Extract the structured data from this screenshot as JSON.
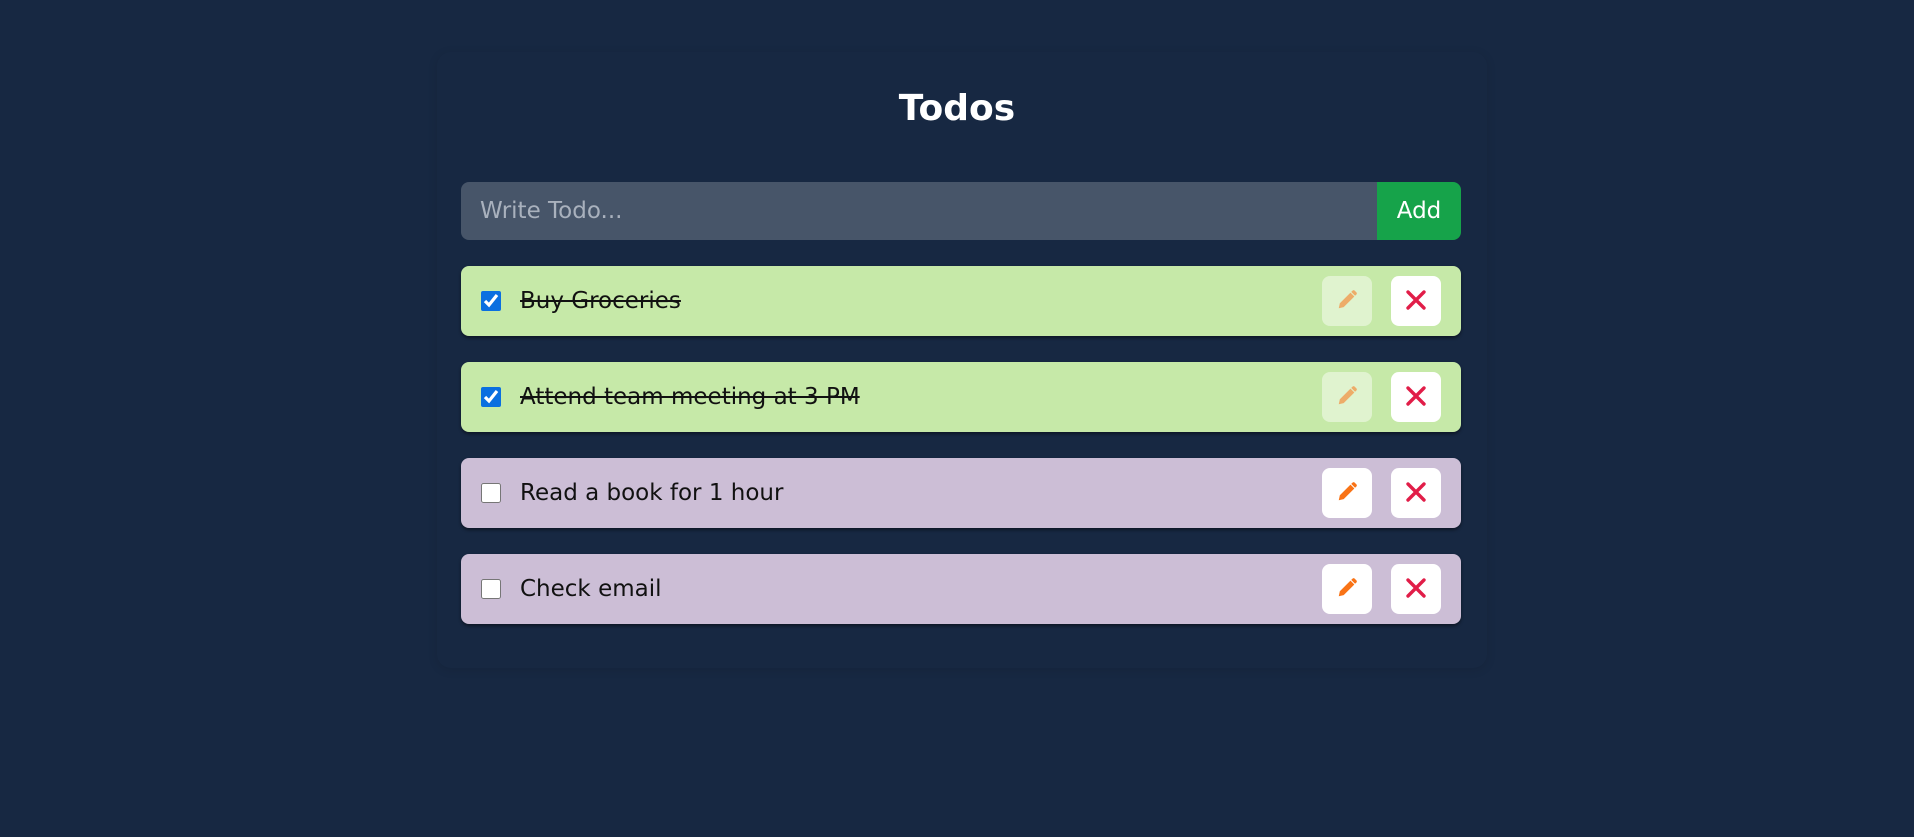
{
  "app": {
    "title": "Todos"
  },
  "form": {
    "placeholder": "Write Todo...",
    "value": "",
    "add_label": "Add"
  },
  "todos": [
    {
      "text": "Buy Groceries",
      "completed": true
    },
    {
      "text": "Attend team meeting at 3 PM",
      "completed": true
    },
    {
      "text": "Read a book for 1 hour",
      "completed": false
    },
    {
      "text": "Check email",
      "completed": false
    }
  ],
  "icons": {
    "edit": "pencil-icon",
    "delete": "close-icon"
  },
  "colors": {
    "background": "#172842",
    "input_background": "#475569",
    "add_button": "#16a34a",
    "completed_item": "#c6e9a8",
    "pending_item": "#ccbed6",
    "pencil": "#f97316",
    "close": "#e11d48"
  }
}
